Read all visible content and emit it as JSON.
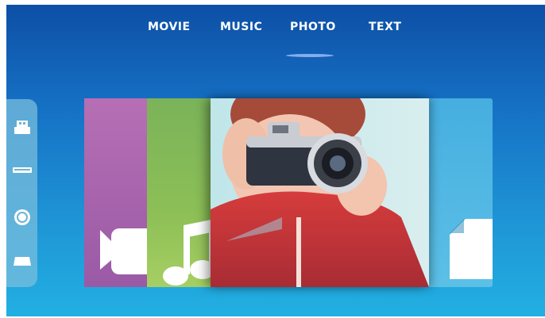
{
  "tabs": [
    {
      "label": "MOVIE"
    },
    {
      "label": "MUSIC"
    },
    {
      "label": "PHOTO"
    },
    {
      "label": "TEXT"
    }
  ],
  "active_tab": "PHOTO",
  "sidebar": {
    "icons": [
      "usb-drive-icon",
      "sd-card-icon",
      "disc-icon",
      "hard-drive-icon"
    ]
  },
  "cards": [
    {
      "category": "MOVIE",
      "icon": "video-camera-icon",
      "color": "#b16fb2"
    },
    {
      "category": "MUSIC",
      "icon": "music-note-icon",
      "color": "#86ba5a"
    },
    {
      "category": "PHOTO",
      "icon": "photo-thumbnail",
      "color": "#c23a3a"
    },
    {
      "category": "TEXT",
      "icon": "document-icon",
      "color": "#4fb6e3"
    }
  ],
  "colors": {
    "background_top": "#0d4fa6",
    "background_bottom": "#22b0e2",
    "text": "#ffffff"
  }
}
